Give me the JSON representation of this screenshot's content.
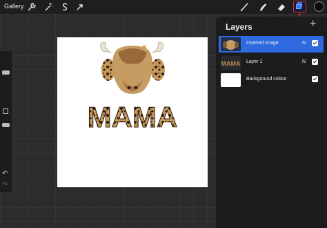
{
  "toolbar": {
    "gallery_label": "Gallery",
    "left_tools": [
      "wrench-icon",
      "magic-wand-icon",
      "selection-icon",
      "transform-arrow-icon"
    ],
    "right_tools": [
      "brush-icon",
      "smudge-icon",
      "eraser-icon",
      "layers-icon"
    ],
    "active_color": "#0b0b0b"
  },
  "annotation": {
    "color": "#e0332e"
  },
  "canvas": {
    "background_color": "#ffffff",
    "artwork_text": "MAMA"
  },
  "layers_panel": {
    "title": "Layers",
    "add_label": "+",
    "layers": [
      {
        "name": "Inserted Image",
        "blend": "N",
        "visible": true,
        "selected": true
      },
      {
        "name": "Layer 1",
        "blend": "N",
        "visible": true,
        "selected": false,
        "thumb_text": "MAMA"
      },
      {
        "name": "Background colour",
        "visible": true,
        "selected": false
      }
    ]
  },
  "sidebar": {
    "undo_label": "↶",
    "redo_label": "↷"
  }
}
